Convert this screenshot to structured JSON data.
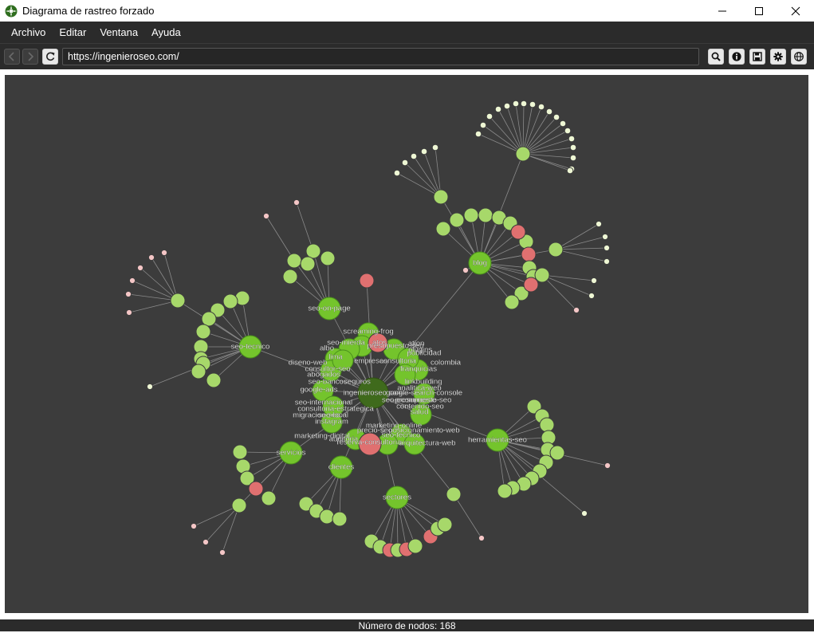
{
  "window": {
    "title": "Diagrama de rastreo forzado"
  },
  "menu": {
    "items": [
      "Archivo",
      "Editar",
      "Ventana",
      "Ayuda"
    ]
  },
  "toolbar": {
    "url": "https://ingenieroseo.com/",
    "icons": [
      "back-icon",
      "forward-icon",
      "refresh-icon",
      "search-icon",
      "info-icon",
      "save-icon",
      "settings-icon",
      "globe-icon"
    ]
  },
  "colors": {
    "background": "#3c3c3c",
    "root": "#3f6a1c",
    "hub": "#74c42c",
    "node": "#a7d86a",
    "leaf": "#eef7d4",
    "error": "#e07070",
    "error_leaf": "#f4c6c6",
    "link": "#8a8a8a"
  },
  "graph": {
    "root_label": "ingenieroseo.com",
    "hub_labels": [
      "blog",
      "seo-on-page",
      "seo-tecnico",
      "servicios",
      "clientes",
      "sectores",
      "herramientas-seo"
    ],
    "cluster_labels": [
      "screaming-frog",
      "seo-mierda",
      "atos",
      "presupuesto-seo",
      "ation",
      "plugins",
      "publicidad",
      "albo",
      "lima",
      "empresas",
      "consultoria",
      "colombia",
      "diseno-web",
      "consultor-seo",
      "franquicias",
      "abogados",
      "seo-bancos",
      "seguros",
      "linkbuilding",
      "analitica-web",
      "google-ads",
      "google-search-console",
      "seo-ecommerce",
      "seo-internacional",
      "presupuesto-seo",
      "consultoria-estrategica",
      "contenido-seo",
      "migracion-seo",
      "salud",
      "instagram",
      "seo-local",
      "marketing-online",
      "posicionamiento-web",
      "marketing-digital",
      "auditoria",
      "reserva-consultoria",
      "seo-tecnico",
      "arquitectura-web",
      "precio-seo"
    ]
  },
  "status": {
    "node_count_label": "Número de nodos: 168"
  }
}
